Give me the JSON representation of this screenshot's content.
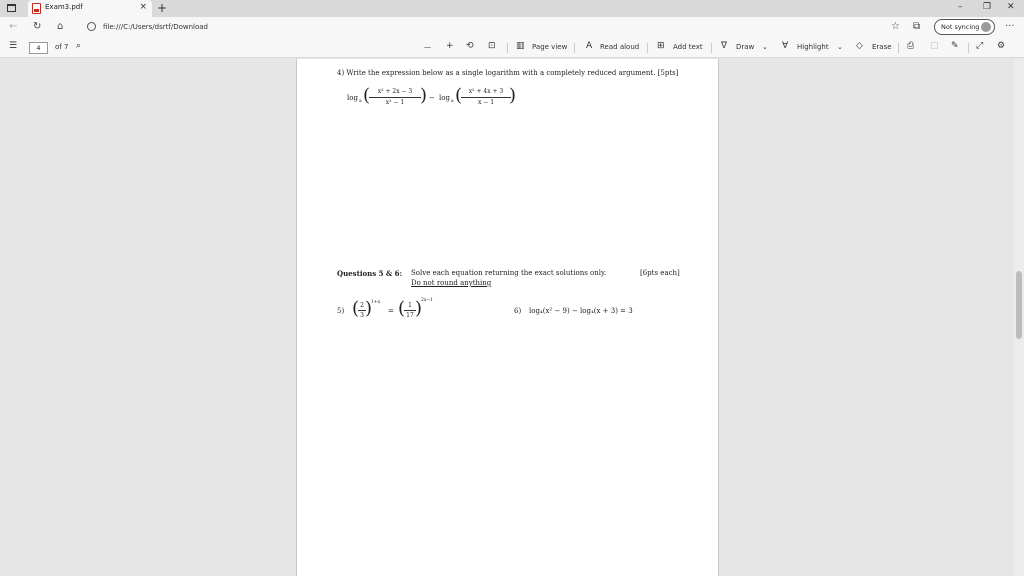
{
  "browser": {
    "tab_title": "Exam3.pdf",
    "tab_close": "×",
    "new_tab": "+",
    "url": "file:///C:/Users/dsrtf/Download",
    "not_syncing": "Not syncing",
    "more": "···",
    "minimize": "–",
    "restore": "❐",
    "close": "✕"
  },
  "pdf_toolbar": {
    "page_number": "4",
    "page_total": "of 7",
    "zoom_out": "—",
    "zoom_in": "+",
    "page_view": "Page view",
    "read_aloud": "Read aloud",
    "add_text": "Add text",
    "draw": "Draw",
    "highlight": "Highlight",
    "erase": "Erase"
  },
  "document": {
    "q4_text": "4) Write the expression below as a single logarithm with a completely reduced argument. [5pts]",
    "q4_log1": "log",
    "q4_base": "a",
    "q4_num1": "x² + 2x − 3",
    "q4_den1": "x² − 1",
    "q4_minus": "−",
    "q4_log2": "log",
    "q4_num2": "x² + 4x + 3",
    "q4_den2": "x − 1",
    "q56_heading": "Questions 5 & 6:",
    "q56_text": "Solve each equation returning the exact solutions only.",
    "q56_pts": "[6pts each]",
    "q56_note": "Do not round anything",
    "q5_label": "5)",
    "q5_num1": "2",
    "q5_den1": "3",
    "q5_exp1": "1+x",
    "q5_eq": "=",
    "q5_num2": "1",
    "q5_den2": "17",
    "q5_exp2": "2x−1",
    "q6_label": "6)",
    "q6_expr": "log₄(x² − 9) − log₄(x + 3) = 3"
  }
}
